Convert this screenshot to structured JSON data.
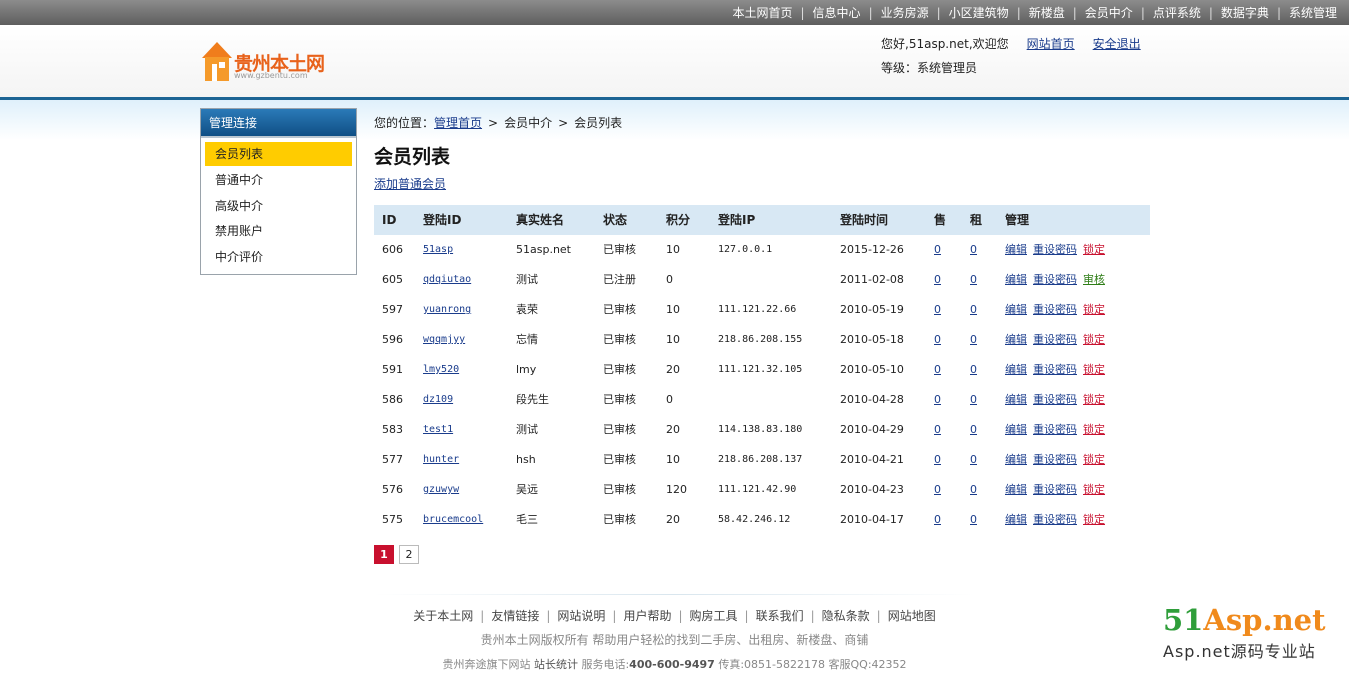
{
  "topnav": [
    "本土网首页",
    "信息中心",
    "业务房源",
    "小区建筑物",
    "新楼盘",
    "会员中介",
    "点评系统",
    "数据字典",
    "系统管理"
  ],
  "header": {
    "logo_text": "贵州本土网",
    "logo_sub": "www.gzbentu.com",
    "welcome": "您好,51asp.net,欢迎您",
    "home_link": "网站首页",
    "logout_link": "安全退出",
    "level": "等级：系统管理员"
  },
  "sidebar": {
    "title": "管理连接",
    "items": [
      "会员列表",
      "普通中介",
      "高级中介",
      "禁用账户",
      "中介评价"
    ]
  },
  "breadcrumb": {
    "prefix": "您的位置：",
    "home": "管理首页",
    "gt": ">",
    "section": "会员中介",
    "current": "会员列表"
  },
  "main": {
    "title": "会员列表",
    "add_link": "添加普通会员"
  },
  "table": {
    "headers": [
      "ID",
      "登陆ID",
      "真实姓名",
      "状态",
      "积分",
      "登陆IP",
      "登陆时间",
      "售",
      "租",
      "管理"
    ],
    "actions": {
      "edit": "编辑",
      "reset": "重设密码",
      "lock": "锁定",
      "audit": "审核"
    },
    "rows": [
      {
        "id": "606",
        "login": "51asp",
        "name": "51asp.net",
        "status": "已审核",
        "score": "10",
        "ip": "127.0.0.1",
        "time": "2015-12-26",
        "sell": "0",
        "rent": "0",
        "action3": "锁定"
      },
      {
        "id": "605",
        "login": "qdqiutao",
        "name": "测试",
        "status": "已注册",
        "score": "0",
        "ip": "",
        "time": "2011-02-08",
        "sell": "0",
        "rent": "0",
        "action3": "审核"
      },
      {
        "id": "597",
        "login": "yuanrong",
        "name": "袁荣",
        "status": "已审核",
        "score": "10",
        "ip": "111.121.22.66",
        "time": "2010-05-19",
        "sell": "0",
        "rent": "0",
        "action3": "锁定"
      },
      {
        "id": "596",
        "login": "wqqmjyy",
        "name": "忘情",
        "status": "已审核",
        "score": "10",
        "ip": "218.86.208.155",
        "time": "2010-05-18",
        "sell": "0",
        "rent": "0",
        "action3": "锁定"
      },
      {
        "id": "591",
        "login": "lmy520",
        "name": "lmy",
        "status": "已审核",
        "score": "20",
        "ip": "111.121.32.105",
        "time": "2010-05-10",
        "sell": "0",
        "rent": "0",
        "action3": "锁定"
      },
      {
        "id": "586",
        "login": "dz109",
        "name": "段先生",
        "status": "已审核",
        "score": "0",
        "ip": "",
        "time": "2010-04-28",
        "sell": "0",
        "rent": "0",
        "action3": "锁定"
      },
      {
        "id": "583",
        "login": "test1",
        "name": "测试",
        "status": "已审核",
        "score": "20",
        "ip": "114.138.83.180",
        "time": "2010-04-29",
        "sell": "0",
        "rent": "0",
        "action3": "锁定"
      },
      {
        "id": "577",
        "login": "hunter",
        "name": "hsh",
        "status": "已审核",
        "score": "10",
        "ip": "218.86.208.137",
        "time": "2010-04-21",
        "sell": "0",
        "rent": "0",
        "action3": "锁定"
      },
      {
        "id": "576",
        "login": "gzuwyw",
        "name": "吴远",
        "status": "已审核",
        "score": "120",
        "ip": "111.121.42.90",
        "time": "2010-04-23",
        "sell": "0",
        "rent": "0",
        "action3": "锁定"
      },
      {
        "id": "575",
        "login": "brucemcool",
        "name": "毛三",
        "status": "已审核",
        "score": "20",
        "ip": "58.42.246.12",
        "time": "2010-04-17",
        "sell": "0",
        "rent": "0",
        "action3": "锁定"
      }
    ]
  },
  "pager": [
    "1",
    "2"
  ],
  "footer": {
    "links": [
      "关于本土网",
      "友情链接",
      "网站说明",
      "用户帮助",
      "购房工具",
      "联系我们",
      "隐私条款",
      "网站地图"
    ],
    "copyright": "贵州本土网版权所有 帮助用户轻松的找到二手房、出租房、新楼盘、商铺",
    "company": "贵州奔途旗下网站",
    "stats": "站长统计",
    "phone_label": "服务电话:",
    "phone": "400-600-9497",
    "fax": "传真:0851-5822178",
    "qq": "客服QQ:42352"
  },
  "watermark": {
    "n51": "51",
    "asp": "Asp",
    "net": ".net",
    "sub": "Asp.net源码专业站"
  },
  "colors": {
    "accent": "#1c6494",
    "active": "#ffcc00",
    "lock": "#c8102e",
    "audit": "#2e7d16"
  }
}
